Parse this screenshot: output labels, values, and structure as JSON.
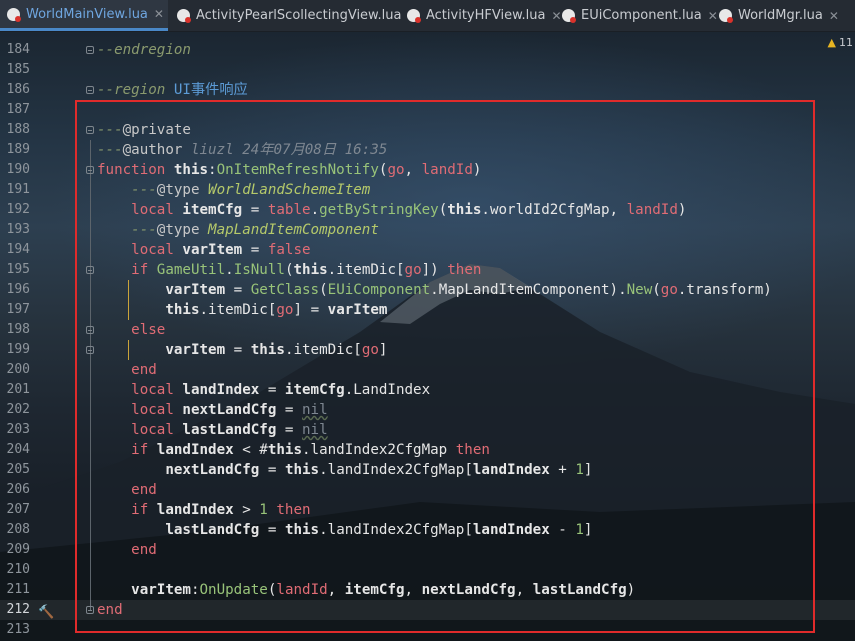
{
  "tabs": [
    {
      "label": "WorldMainView.lua",
      "active": true
    },
    {
      "label": "ActivityPearlScollectingView.lua",
      "active": false
    },
    {
      "label": "ActivityHFView.lua",
      "active": false
    },
    {
      "label": "EUiComponent.lua",
      "active": false
    },
    {
      "label": "WorldMgr.lua",
      "active": false
    }
  ],
  "inspection": {
    "icon": "warning-triangle-icon",
    "count": "11"
  },
  "colors": {
    "accent": "#4a88c7",
    "selection_border": "#e02b2b",
    "keyword": "#e06c75",
    "function": "#98c379"
  },
  "lines": [
    {
      "n": "184",
      "s": [
        {
          "c": "cm",
          "t": "--endregion"
        }
      ]
    },
    {
      "n": "185",
      "s": []
    },
    {
      "n": "186",
      "s": [
        {
          "c": "cm",
          "t": "--region "
        },
        {
          "c": "reg",
          "t": "UI事件响应"
        }
      ]
    },
    {
      "n": "187",
      "s": []
    },
    {
      "n": "188",
      "s": [
        {
          "c": "cm",
          "t": "---"
        },
        {
          "c": "an",
          "t": "@private"
        }
      ]
    },
    {
      "n": "189",
      "s": [
        {
          "c": "cm",
          "t": "---"
        },
        {
          "c": "an",
          "t": "@author "
        },
        {
          "c": "au",
          "t": "liuzl 24年07月08日 16:35"
        }
      ]
    },
    {
      "n": "190",
      "s": [
        {
          "c": "kw",
          "t": "function "
        },
        {
          "c": "th",
          "t": "this"
        },
        {
          "c": "",
          "t": ":"
        },
        {
          "c": "fn",
          "t": "OnItemRefreshNotify"
        },
        {
          "c": "",
          "t": "("
        },
        {
          "c": "pa",
          "t": "go"
        },
        {
          "c": "",
          "t": ", "
        },
        {
          "c": "pa",
          "t": "landId"
        },
        {
          "c": "",
          "t": ")"
        }
      ]
    },
    {
      "n": "191",
      "s": [
        {
          "c": "",
          "t": "    "
        },
        {
          "c": "cm",
          "t": "---"
        },
        {
          "c": "an",
          "t": "@type "
        },
        {
          "c": "ty",
          "t": "WorldLandSchemeItem"
        }
      ]
    },
    {
      "n": "192",
      "s": [
        {
          "c": "",
          "t": "    "
        },
        {
          "c": "kw",
          "t": "local "
        },
        {
          "c": "th",
          "t": "itemCfg"
        },
        {
          "c": "",
          "t": " = "
        },
        {
          "c": "kw",
          "t": "table"
        },
        {
          "c": "",
          "t": "."
        },
        {
          "c": "fn",
          "t": "getByStringKey"
        },
        {
          "c": "",
          "t": "("
        },
        {
          "c": "th",
          "t": "this"
        },
        {
          "c": "",
          "t": ".worldId2CfgMap, "
        },
        {
          "c": "pa",
          "t": "landId"
        },
        {
          "c": "",
          "t": ")"
        }
      ]
    },
    {
      "n": "193",
      "s": [
        {
          "c": "",
          "t": "    "
        },
        {
          "c": "cm",
          "t": "---"
        },
        {
          "c": "an",
          "t": "@type "
        },
        {
          "c": "ty",
          "t": "MapLandItemComponent"
        }
      ]
    },
    {
      "n": "194",
      "s": [
        {
          "c": "",
          "t": "    "
        },
        {
          "c": "kw",
          "t": "local "
        },
        {
          "c": "th",
          "t": "varItem"
        },
        {
          "c": "",
          "t": " = "
        },
        {
          "c": "kw",
          "t": "false"
        }
      ]
    },
    {
      "n": "195",
      "s": [
        {
          "c": "",
          "t": "    "
        },
        {
          "c": "kw",
          "t": "if "
        },
        {
          "c": "fn",
          "t": "GameUtil"
        },
        {
          "c": "",
          "t": "."
        },
        {
          "c": "fn",
          "t": "IsNull"
        },
        {
          "c": "",
          "t": "("
        },
        {
          "c": "th",
          "t": "this"
        },
        {
          "c": "",
          "t": ".itemDic["
        },
        {
          "c": "pa",
          "t": "go"
        },
        {
          "c": "",
          "t": "]) "
        },
        {
          "c": "kw",
          "t": "then"
        }
      ]
    },
    {
      "n": "196",
      "s": [
        {
          "c": "",
          "t": "        "
        },
        {
          "c": "th",
          "t": "varItem"
        },
        {
          "c": "",
          "t": " = "
        },
        {
          "c": "fn",
          "t": "GetClass"
        },
        {
          "c": "",
          "t": "("
        },
        {
          "c": "fn",
          "t": "EUiComponent"
        },
        {
          "c": "",
          "t": ".MapLandItemComponent)."
        },
        {
          "c": "fn",
          "t": "New"
        },
        {
          "c": "",
          "t": "("
        },
        {
          "c": "pa",
          "t": "go"
        },
        {
          "c": "",
          "t": ".transform)"
        }
      ]
    },
    {
      "n": "197",
      "s": [
        {
          "c": "",
          "t": "        "
        },
        {
          "c": "th",
          "t": "this"
        },
        {
          "c": "",
          "t": ".itemDic["
        },
        {
          "c": "pa",
          "t": "go"
        },
        {
          "c": "",
          "t": "] = "
        },
        {
          "c": "th",
          "t": "varItem"
        }
      ]
    },
    {
      "n": "198",
      "s": [
        {
          "c": "",
          "t": "    "
        },
        {
          "c": "kw",
          "t": "else"
        }
      ]
    },
    {
      "n": "199",
      "s": [
        {
          "c": "",
          "t": "        "
        },
        {
          "c": "th",
          "t": "varItem"
        },
        {
          "c": "",
          "t": " = "
        },
        {
          "c": "th",
          "t": "this"
        },
        {
          "c": "",
          "t": ".itemDic["
        },
        {
          "c": "pa",
          "t": "go"
        },
        {
          "c": "",
          "t": "]"
        }
      ]
    },
    {
      "n": "200",
      "s": [
        {
          "c": "",
          "t": "    "
        },
        {
          "c": "kw",
          "t": "end"
        }
      ]
    },
    {
      "n": "201",
      "s": [
        {
          "c": "",
          "t": "    "
        },
        {
          "c": "kw",
          "t": "local "
        },
        {
          "c": "th",
          "t": "landIndex"
        },
        {
          "c": "",
          "t": " = "
        },
        {
          "c": "th",
          "t": "itemCfg"
        },
        {
          "c": "",
          "t": ".LandIndex"
        }
      ]
    },
    {
      "n": "202",
      "s": [
        {
          "c": "",
          "t": "    "
        },
        {
          "c": "kw",
          "t": "local "
        },
        {
          "c": "th",
          "t": "nextLandCfg"
        },
        {
          "c": "",
          "t": " = "
        },
        {
          "c": "ni",
          "t": "nil"
        }
      ]
    },
    {
      "n": "203",
      "s": [
        {
          "c": "",
          "t": "    "
        },
        {
          "c": "kw",
          "t": "local "
        },
        {
          "c": "th",
          "t": "lastLandCfg"
        },
        {
          "c": "",
          "t": " = "
        },
        {
          "c": "ni",
          "t": "nil"
        }
      ]
    },
    {
      "n": "204",
      "s": [
        {
          "c": "",
          "t": "    "
        },
        {
          "c": "kw",
          "t": "if "
        },
        {
          "c": "th",
          "t": "landIndex"
        },
        {
          "c": "",
          "t": " < #"
        },
        {
          "c": "th",
          "t": "this"
        },
        {
          "c": "",
          "t": ".landIndex2CfgMap "
        },
        {
          "c": "kw",
          "t": "then"
        }
      ]
    },
    {
      "n": "205",
      "s": [
        {
          "c": "",
          "t": "        "
        },
        {
          "c": "th",
          "t": "nextLandCfg"
        },
        {
          "c": "",
          "t": " = "
        },
        {
          "c": "th",
          "t": "this"
        },
        {
          "c": "",
          "t": ".landIndex2CfgMap["
        },
        {
          "c": "th",
          "t": "landIndex"
        },
        {
          "c": "",
          "t": " + "
        },
        {
          "c": "nu",
          "t": "1"
        },
        {
          "c": "",
          "t": "]"
        }
      ]
    },
    {
      "n": "206",
      "s": [
        {
          "c": "",
          "t": "    "
        },
        {
          "c": "kw",
          "t": "end"
        }
      ]
    },
    {
      "n": "207",
      "s": [
        {
          "c": "",
          "t": "    "
        },
        {
          "c": "kw",
          "t": "if "
        },
        {
          "c": "th",
          "t": "landIndex"
        },
        {
          "c": "",
          "t": " > "
        },
        {
          "c": "nu",
          "t": "1"
        },
        {
          "c": "",
          "t": " "
        },
        {
          "c": "kw",
          "t": "then"
        }
      ]
    },
    {
      "n": "208",
      "s": [
        {
          "c": "",
          "t": "        "
        },
        {
          "c": "th",
          "t": "lastLandCfg"
        },
        {
          "c": "",
          "t": " = "
        },
        {
          "c": "th",
          "t": "this"
        },
        {
          "c": "",
          "t": ".landIndex2CfgMap["
        },
        {
          "c": "th",
          "t": "landIndex"
        },
        {
          "c": "",
          "t": " - "
        },
        {
          "c": "nu",
          "t": "1"
        },
        {
          "c": "",
          "t": "]"
        }
      ]
    },
    {
      "n": "209",
      "s": [
        {
          "c": "",
          "t": "    "
        },
        {
          "c": "kw",
          "t": "end"
        }
      ]
    },
    {
      "n": "210",
      "s": []
    },
    {
      "n": "211",
      "s": [
        {
          "c": "",
          "t": "    "
        },
        {
          "c": "th",
          "t": "varItem"
        },
        {
          "c": "",
          "t": ":"
        },
        {
          "c": "fn",
          "t": "OnUpdate"
        },
        {
          "c": "",
          "t": "("
        },
        {
          "c": "pa",
          "t": "landId"
        },
        {
          "c": "",
          "t": ", "
        },
        {
          "c": "th",
          "t": "itemCfg"
        },
        {
          "c": "",
          "t": ", "
        },
        {
          "c": "th",
          "t": "nextLandCfg"
        },
        {
          "c": "",
          "t": ", "
        },
        {
          "c": "th",
          "t": "lastLandCfg"
        },
        {
          "c": "",
          "t": ")"
        }
      ]
    },
    {
      "n": "212",
      "s": [
        {
          "c": "kw",
          "t": "end"
        }
      ],
      "current": true,
      "gutter_icon": "hammer-icon"
    },
    {
      "n": "213",
      "s": []
    }
  ]
}
